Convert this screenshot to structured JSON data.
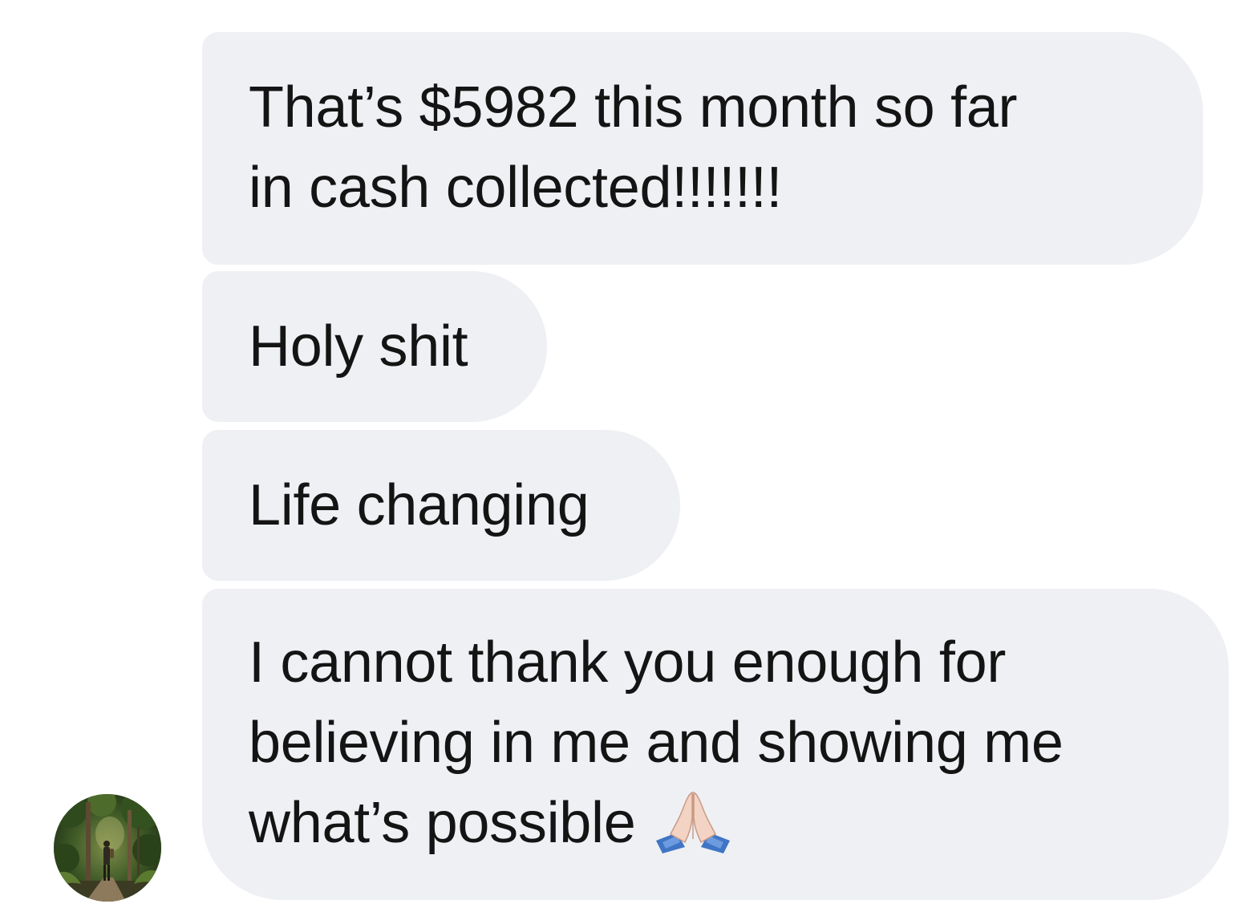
{
  "conversation": {
    "messages": [
      {
        "lines": [
          "That’s $5982 this month so far",
          "in cash collected!!!!!!!"
        ]
      },
      {
        "lines": [
          "Holy shit"
        ]
      },
      {
        "lines": [
          "Life changing"
        ]
      },
      {
        "lines": [
          "I cannot thank you enough for",
          "believing in me and showing me",
          "what’s possible"
        ],
        "emoji": "folded-hands-icon"
      }
    ],
    "colors": {
      "bubble_background": "#eff0f4",
      "text": "#141414"
    },
    "sender_avatar": "avatar-forest-photo"
  }
}
